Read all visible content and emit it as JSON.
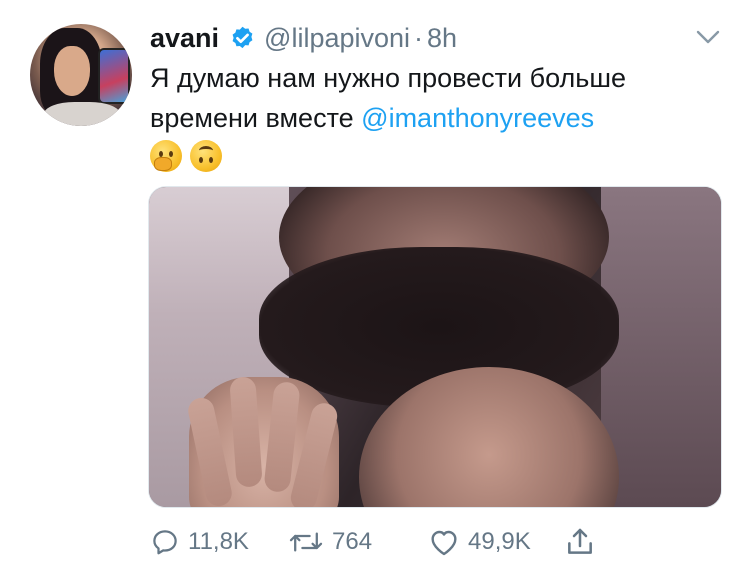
{
  "tweet": {
    "author_name": "avani",
    "handle": "@lilpapivoni",
    "separator": "·",
    "time": "8h",
    "text_main": "Я думаю нам нужно провести больше времени вместе ",
    "mention": "@imanthonyreeves",
    "emojis": [
      "face-with-hand-over-mouth",
      "upside-down-face"
    ]
  },
  "actions": {
    "reply_count": "11,8K",
    "retweet_count": "764",
    "like_count": "49,9K"
  },
  "colors": {
    "link": "#1da1f2",
    "verified": "#1da1f2",
    "muted": "#657786",
    "text": "#14171a"
  }
}
